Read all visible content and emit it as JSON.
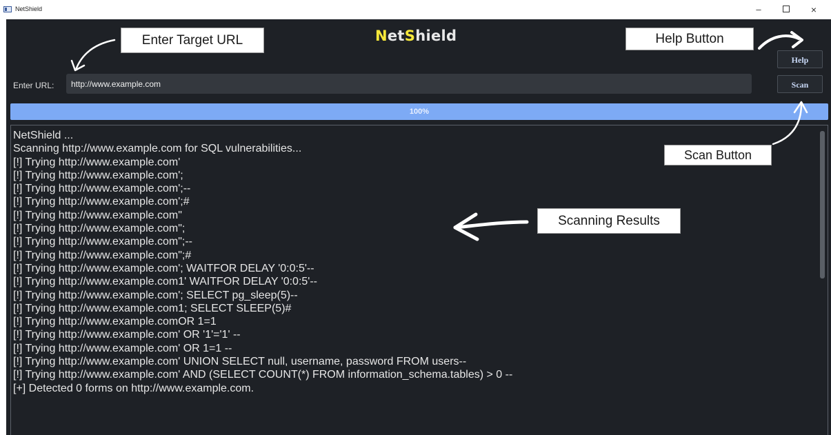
{
  "window": {
    "title": "NetShield",
    "controls": {
      "minimize": "–",
      "close": "×"
    }
  },
  "app": {
    "title_parts": [
      "N",
      "et",
      "S",
      "hield"
    ],
    "help_label": "Help",
    "scan_label": "Scan",
    "url_label": "Enter URL:",
    "url_value": "http://www.example.com",
    "progress": {
      "value": 100,
      "text": "100%"
    }
  },
  "results": {
    "lines": [
      " NetShield ...",
      "Scanning http://www.example.com for SQL vulnerabilities...",
      "[!] Trying http://www.example.com'",
      "[!] Trying http://www.example.com';",
      "[!] Trying http://www.example.com';--",
      "[!] Trying http://www.example.com';#",
      "[!] Trying http://www.example.com\"",
      "[!] Trying http://www.example.com\";",
      "[!] Trying http://www.example.com\";--",
      "[!] Trying http://www.example.com\";#",
      "[!] Trying http://www.example.com'; WAITFOR DELAY '0:0:5'--",
      "[!] Trying http://www.example.com1' WAITFOR DELAY '0:0:5'--",
      "[!] Trying http://www.example.com'; SELECT pg_sleep(5)--",
      "[!] Trying http://www.example.com1; SELECT SLEEP(5)#",
      "[!] Trying http://www.example.comOR 1=1",
      "[!] Trying http://www.example.com' OR '1'='1' --",
      "[!] Trying http://www.example.com' OR 1=1 --",
      "[!] Trying http://www.example.com' UNION SELECT null, username, password FROM users--",
      "[!] Trying http://www.example.com' AND (SELECT COUNT(*) FROM information_schema.tables) > 0 --",
      "[+] Detected 0 forms on http://www.example.com."
    ]
  },
  "annotations": {
    "enter_target_url": "Enter Target URL",
    "help_button": "Help Button",
    "scan_button": "Scan Button",
    "scanning_results": "Scanning Results"
  },
  "colors": {
    "background": "#1e2126",
    "accent_yellow": "#f7e83a",
    "progress_fill": "#7daaf5",
    "button_text": "#c8d8f6"
  },
  "icons": [
    "app-window-icon",
    "minimize-icon",
    "maximize-icon",
    "close-icon",
    "annotation-arrow-icon"
  ]
}
